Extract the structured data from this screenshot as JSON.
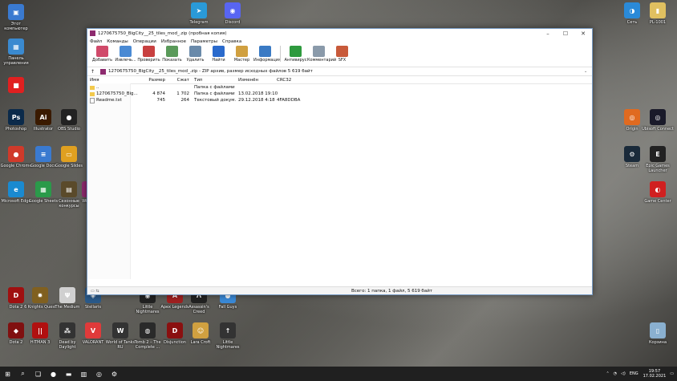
{
  "window": {
    "title": "1270675750_BigCity__25_tiles_mod_.zip (пробная копия)",
    "controls": [
      "–",
      "☐",
      "✕"
    ]
  },
  "menu": [
    "Файл",
    "Команды",
    "Операции",
    "Избранное",
    "Параметры",
    "Справка"
  ],
  "toolbar": [
    {
      "label": "Добавить",
      "color": "#d04a6a",
      "icon": "add-icon"
    },
    {
      "label": "Извлечь...",
      "color": "#4a8ad4",
      "icon": "extract-icon"
    },
    {
      "label": "Проверить",
      "color": "#c84040",
      "icon": "test-icon"
    },
    {
      "label": "Показать",
      "color": "#5a9a5a",
      "icon": "view-icon"
    },
    {
      "label": "Удалить",
      "color": "#6a8aaa",
      "icon": "delete-icon"
    },
    {
      "label": "Найти",
      "color": "#2a6acc",
      "icon": "find-icon"
    },
    {
      "label": "Мастер",
      "color": "#d0a040",
      "icon": "wizard-icon"
    },
    {
      "label": "Информация",
      "color": "#3a7ac4",
      "icon": "info-icon"
    },
    {
      "label": "Антивирус",
      "color": "#2e9a3e",
      "icon": "antivirus-icon"
    },
    {
      "label": "Комментарий",
      "color": "#8a9aaa",
      "icon": "comment-icon"
    },
    {
      "label": "SFX",
      "color": "#c85a3a",
      "icon": "sfx-icon"
    }
  ],
  "path": {
    "up": "↑",
    "text": "1270675750_BigCity__25_tiles_mod_.zip - ZIP архив, размер исходных файлов 5 619 байт",
    "dropdown": "⌄"
  },
  "columns": {
    "name": "Имя",
    "size": "Размер",
    "packed": "Сжат",
    "type": "Тип",
    "modified": "Изменён",
    "crc": "CRC32"
  },
  "rows": [
    {
      "name": "..",
      "size": "",
      "packed": "",
      "type": "Папка с файлами",
      "modified": "",
      "crc": "",
      "icon": "folder"
    },
    {
      "name": "1270675750_Big...",
      "size": "4 874",
      "packed": "1 702",
      "type": "Папка с файлами",
      "modified": "13.02.2018 19:10",
      "crc": "",
      "icon": "folder"
    },
    {
      "name": "Readme.txt",
      "size": "745",
      "packed": "264",
      "type": "Текстовый докум...",
      "modified": "29.12.2018 4:18",
      "crc": "4FA8DDBA",
      "icon": "txt"
    }
  ],
  "status": "Всего: 1 папка, 1 файл, 5 619 байт",
  "desktop": {
    "left": [
      {
        "label": "Этот компьютер",
        "color": "#3a7ad0",
        "glyph": "▣"
      },
      {
        "label": "Панель управления",
        "color": "#3a8ad0",
        "glyph": "▦"
      },
      {
        "label": "",
        "color": "#e02020",
        "glyph": "■"
      },
      {
        "label": "Photoshop",
        "color": "#0b2a4a",
        "glyph": "Ps"
      },
      {
        "label": "Illustrator",
        "color": "#3a1a00",
        "glyph": "Ai"
      },
      {
        "label": "OBS Studio",
        "color": "#222",
        "glyph": "●"
      },
      {
        "label": "Google Chrome",
        "color": "#d03a2a",
        "glyph": "●"
      },
      {
        "label": "Google Docs",
        "color": "#3a7ad0",
        "glyph": "≡"
      },
      {
        "label": "Google Slides",
        "color": "#e0a020",
        "glyph": "▭"
      },
      {
        "label": "Microsoft Edge",
        "color": "#1a8ad0",
        "glyph": "e"
      },
      {
        "label": "Google Sheets",
        "color": "#2a9a4a",
        "glyph": "▦"
      },
      {
        "label": "Сезонные конкурсы",
        "color": "#5a4a2a",
        "glyph": "▤"
      },
      {
        "label": "WinRAR",
        "color": "#8e2b6f",
        "glyph": "▥"
      }
    ],
    "top": [
      {
        "label": "Telegram",
        "color": "#2a9ad8",
        "glyph": "➤"
      },
      {
        "label": "Discord",
        "color": "#5865f2",
        "glyph": "◉"
      }
    ],
    "right": [
      {
        "label": "Сеть",
        "color": "#2a8ad8",
        "glyph": "◑"
      },
      {
        "label": "PL-1001",
        "color": "#e0c060",
        "glyph": "▮"
      },
      {
        "label": "Origin",
        "color": "#e06a20",
        "glyph": "◎"
      },
      {
        "label": "Ubisoft Connect",
        "color": "#1a1a2a",
        "glyph": "◎"
      },
      {
        "label": "Steam",
        "color": "#1a2a3a",
        "glyph": "⚙"
      },
      {
        "label": "Epic Games Launcher",
        "color": "#222",
        "glyph": "E"
      },
      {
        "label": "Game Center",
        "color": "#d02020",
        "glyph": "◐"
      },
      {
        "label": "Корзина",
        "color": "#8ab0d0",
        "glyph": "▯"
      }
    ],
    "bottom1": [
      {
        "label": "Dota 2",
        "color": "#a01010",
        "glyph": "D"
      },
      {
        "label": "6 Knights Quest",
        "color": "#806020",
        "glyph": "✹"
      },
      {
        "label": "The Medium",
        "color": "#d0d0d0",
        "glyph": "Ψ"
      },
      {
        "label": "Stellaris",
        "color": "#2a5a8a",
        "glyph": "◈"
      },
      {
        "label": "Little Nightmares",
        "color": "#222",
        "glyph": "◉"
      },
      {
        "label": "Apex Legends",
        "color": "#a02020",
        "glyph": "A"
      },
      {
        "label": "Assassin's Creed",
        "color": "#222",
        "glyph": "Λ"
      },
      {
        "label": "Fall Guys",
        "color": "#3a8ad8",
        "glyph": "●"
      }
    ],
    "bottom2": [
      {
        "label": "Dota 2",
        "color": "#801010",
        "glyph": "◆"
      },
      {
        "label": "HITMAN 3",
        "color": "#b01010",
        "glyph": "||"
      },
      {
        "label": "Dead by Daylight",
        "color": "#333",
        "glyph": "⁂"
      },
      {
        "label": "VALORANT",
        "color": "#e03a3a",
        "glyph": "V"
      },
      {
        "label": "World of Tanks RU",
        "color": "#333",
        "glyph": "W"
      },
      {
        "label": "Tomb 2 – The Complete ...",
        "color": "#2a2a2a",
        "glyph": "◍"
      },
      {
        "label": "Disjunction",
        "color": "#8a1010",
        "glyph": "D"
      },
      {
        "label": "Lara Croft",
        "color": "#d0a040",
        "glyph": "☺"
      },
      {
        "label": "Little Nightmares",
        "color": "#333",
        "glyph": "↑"
      }
    ]
  },
  "taskbar": {
    "items": [
      {
        "glyph": "⊞",
        "icon": "start-icon"
      },
      {
        "glyph": "⌕",
        "icon": "search-icon"
      },
      {
        "glyph": "❏",
        "icon": "task-view-icon"
      },
      {
        "glyph": "●",
        "icon": "chrome-icon"
      },
      {
        "glyph": "▬",
        "icon": "explorer-icon"
      },
      {
        "glyph": "▥",
        "icon": "winrar-icon"
      },
      {
        "glyph": "◎",
        "icon": "app-icon"
      },
      {
        "glyph": "⚙",
        "icon": "steam-icon"
      }
    ],
    "lang": "ENG",
    "time": "19:57",
    "date": "17.02.2021"
  }
}
